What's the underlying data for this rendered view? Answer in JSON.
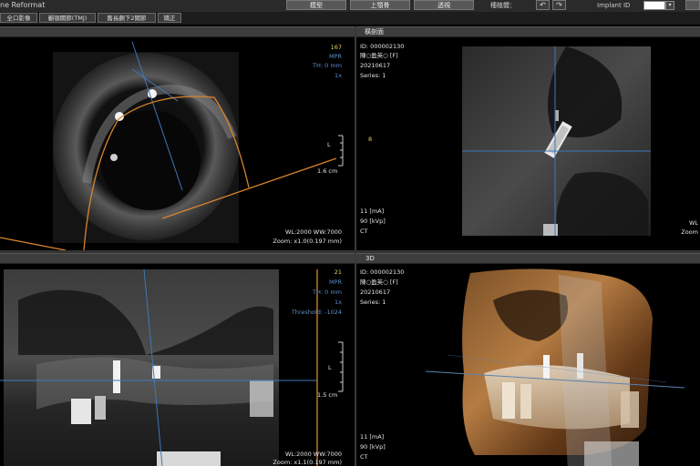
{
  "app": {
    "title": "ne Reformat"
  },
  "toolbar": {
    "buttons": [
      "模型",
      "上顎骨",
      "透視"
    ],
    "plant_label": "種植體：",
    "implant_id_label": "Implant ID",
    "implant_id_value": "",
    "undo_icon": "undo-arrow-icon",
    "redo_icon": "redo-arrow-icon"
  },
  "tabs": [
    "全口影像",
    "顳顎關節(TMJ)",
    "舊長顱下2關節",
    "矯正"
  ],
  "panels": {
    "axial": {
      "slice": "167",
      "mode": "MPR",
      "thickness": "TH: 0 mm",
      "zoom_factor": "1x",
      "scale": "1.6 cm",
      "scale_letter": "L",
      "window": "WL:2000 WW:7000",
      "zoom": "Zoom: x1.0(0.197 mm)"
    },
    "cross": {
      "title": "橫剖面",
      "id": "ID: 000002130",
      "name": "陳○盈英○ [F]",
      "date": "20210617",
      "series": "Series: 1",
      "marker": "8",
      "ma": "11 [mA]",
      "kvp": "90 [kVp]",
      "modality": "CT",
      "right_window": "WL",
      "right_zoom": "Zoom"
    },
    "pano": {
      "slice": "21",
      "mode": "MPR",
      "thickness": "TH: 0 mm",
      "zoom_factor": "1x",
      "threshold": "Threshold: -1024",
      "scale_letter": "L",
      "scale": "1.5 cm",
      "window": "WL:2000 WW:7000",
      "zoom": "Zoom: x1.1(0.197 mm)"
    },
    "threed": {
      "title": "3D",
      "id": "ID: 000002130",
      "name": "陳○盈英○ [F]",
      "date": "20210617",
      "series": "Series: 1",
      "ma": "11 [mA]",
      "kvp": "90 [kVp]",
      "modality": "CT"
    }
  },
  "colors": {
    "crosshair": "#3f78b8",
    "curve": "#d9842c",
    "overlay_blue": "#5c8ec9",
    "overlay_yellow": "#e5d36a"
  }
}
